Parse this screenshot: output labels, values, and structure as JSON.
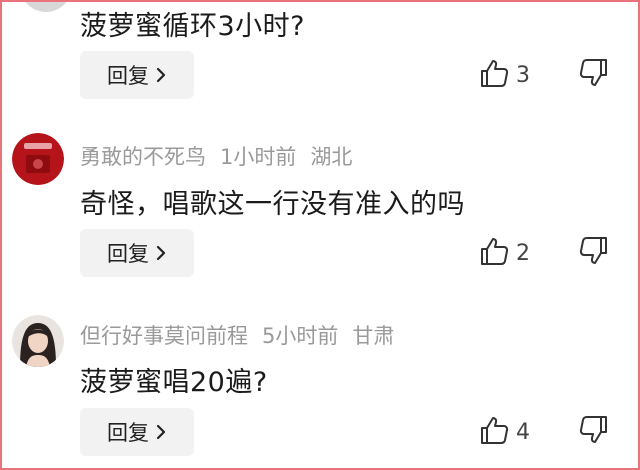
{
  "comments": [
    {
      "author": "",
      "time": "",
      "region": "",
      "text": "菠萝蜜循环3小时?",
      "reply_label": "回复",
      "likes": "3"
    },
    {
      "author": "勇敢的不死鸟",
      "time": "1小时前",
      "region": "湖北",
      "text": "奇怪，唱歌这一行没有准入的吗",
      "reply_label": "回复",
      "likes": "2",
      "avatar_color": "#b5141a"
    },
    {
      "author": "但行好事莫问前程",
      "time": "5小时前",
      "region": "甘肃",
      "text": "菠萝蜜唱20遍?",
      "reply_label": "回复",
      "likes": "4"
    }
  ],
  "icons": {
    "reply_chevron": "chevron-right-icon",
    "like": "thumbs-up-icon",
    "dislike": "thumbs-down-icon"
  },
  "colors": {
    "border": "#e8737a",
    "meta_text": "#9a9a9a",
    "reply_bg": "#f2f2f2"
  }
}
